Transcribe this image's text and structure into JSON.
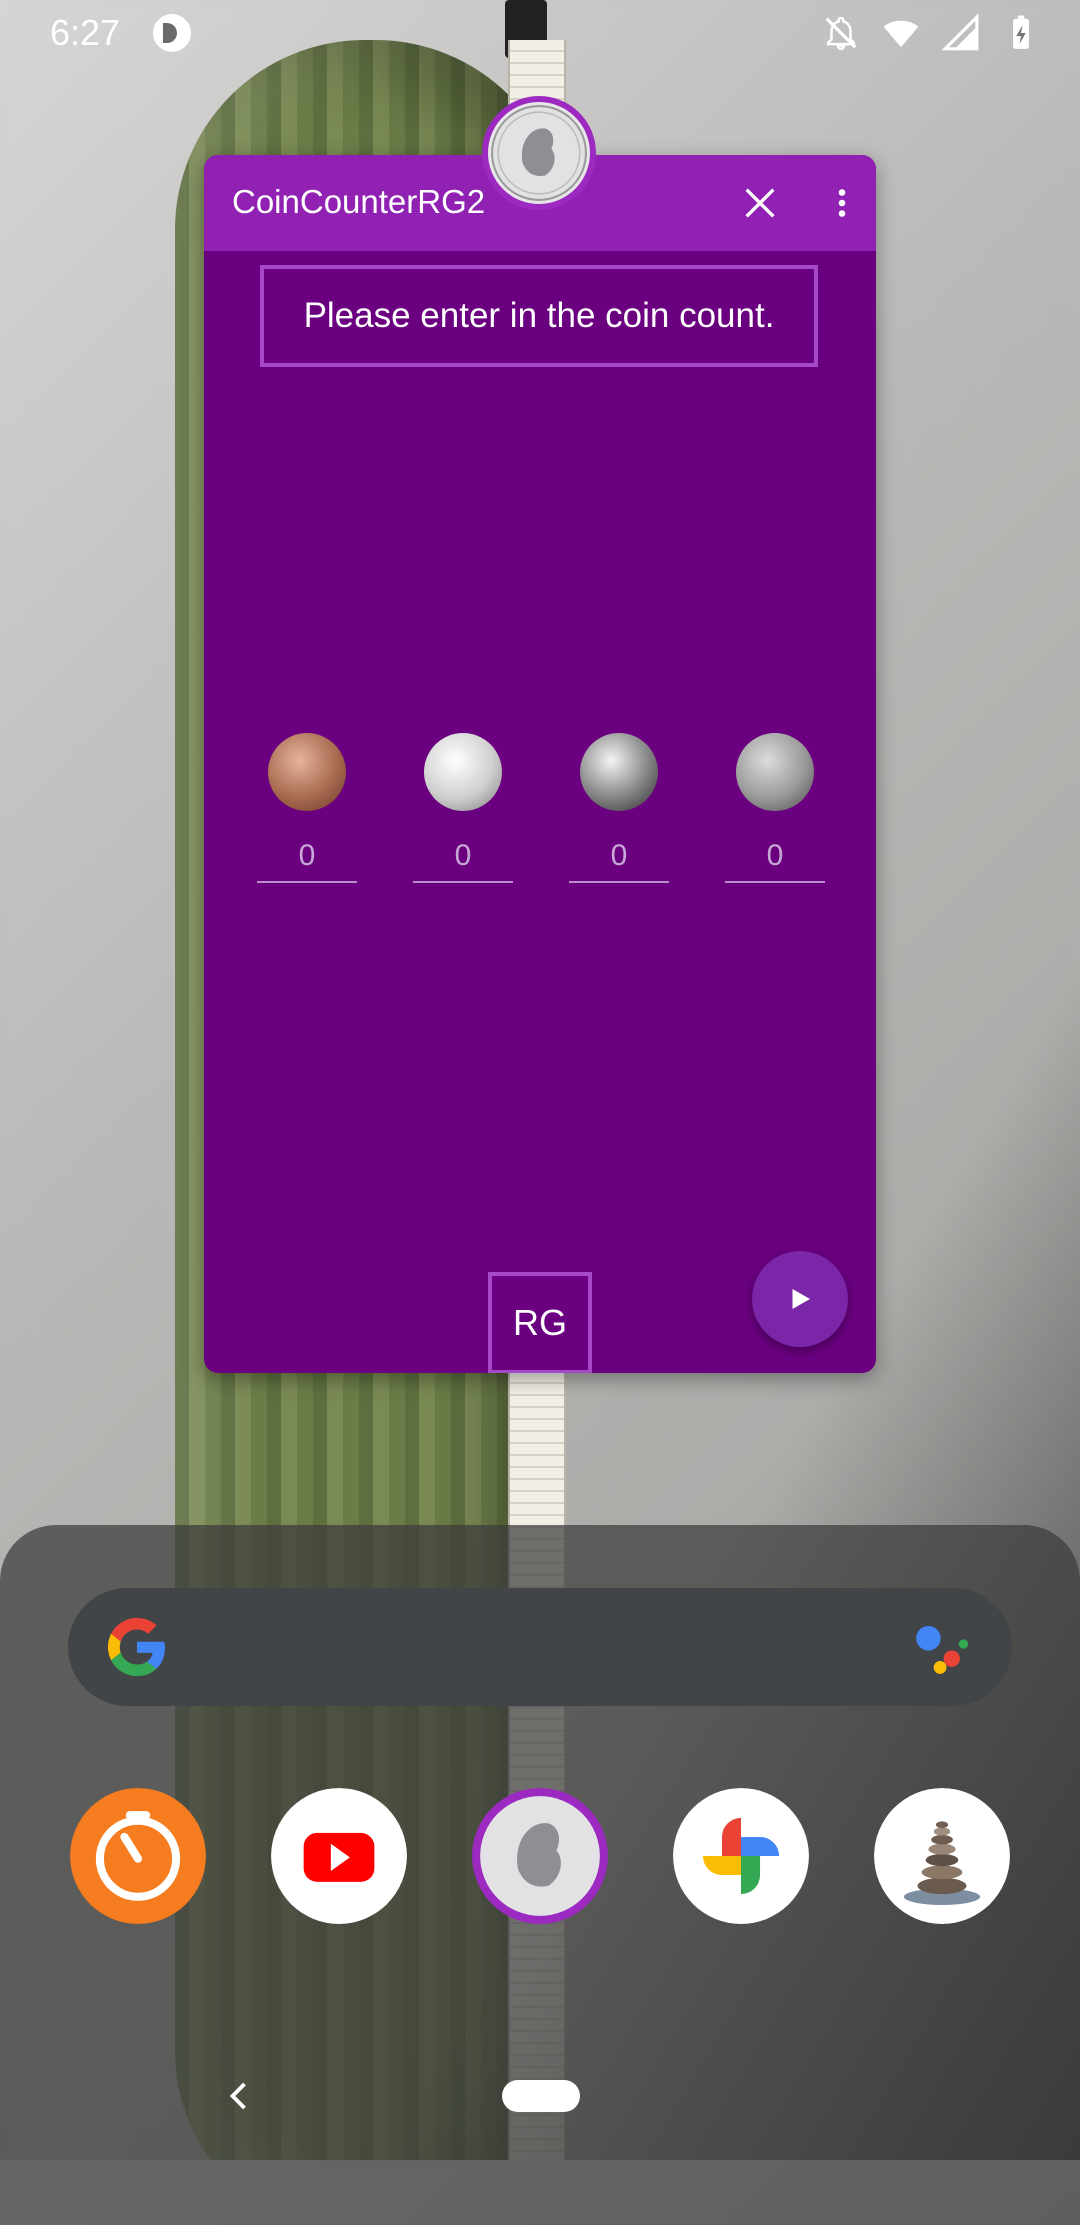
{
  "status_bar": {
    "time": "6:27",
    "icons": [
      "app-indicator-icon",
      "notifications-off-icon",
      "wifi-icon",
      "signal-icon",
      "battery-icon"
    ]
  },
  "floating_window": {
    "title": "CoinCounterRG2",
    "prompt": "Please enter in the coin count.",
    "coins": [
      {
        "name": "penny",
        "value": "0",
        "color": "#b8735a"
      },
      {
        "name": "nickel",
        "value": "0",
        "color": "#cfcfcf"
      },
      {
        "name": "dime",
        "value": "0",
        "color": "#8e8e8e"
      },
      {
        "name": "quarter",
        "value": "0",
        "color": "#9a9a9a"
      }
    ],
    "rg_button": "RG",
    "colors": {
      "window": "#6a0080",
      "titlebar": "#9121b3",
      "accent": "#a649c6"
    }
  },
  "dock": {
    "search_placeholder": "",
    "apps": [
      {
        "name": "timer-app-icon"
      },
      {
        "name": "youtube-app-icon"
      },
      {
        "name": "coincounter-app-icon"
      },
      {
        "name": "photos-app-icon"
      },
      {
        "name": "stones-app-icon"
      }
    ]
  }
}
